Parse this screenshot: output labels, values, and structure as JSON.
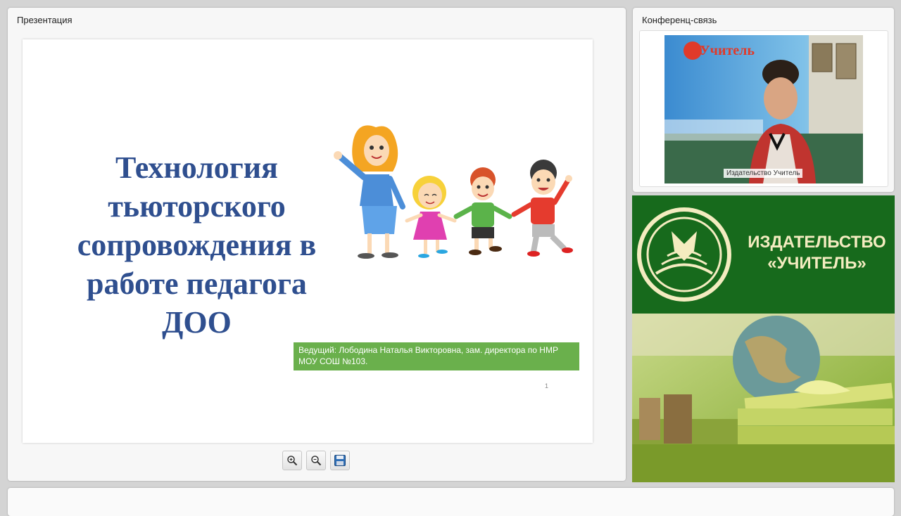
{
  "presentation": {
    "title": "Презентация",
    "slide": {
      "heading_lines": [
        "Технология",
        "тьюторского",
        "сопровождения в",
        "работе педагога",
        "ДОО"
      ],
      "presenter": "Ведущий: Лободина Наталья Викторовна, зам. директора по НМР МОУ СОШ №103.",
      "number": "1"
    },
    "toolbar": [
      {
        "name": "zoom-in-button",
        "icon": "zoom-in-icon"
      },
      {
        "name": "zoom-out-button",
        "icon": "zoom-out-icon"
      },
      {
        "name": "save-button",
        "icon": "save-icon"
      }
    ]
  },
  "conference": {
    "title": "Конференц-связь",
    "video_caption": "Издательство Учитель",
    "backdrop_text": "Учитель"
  },
  "publisher": {
    "name_line1": "ИЗДАТЕЛЬСТВО",
    "name_line2": "«УЧИТЕЛЬ»",
    "colors": {
      "green": "#176a1c",
      "gold": "#f4ecc0"
    }
  },
  "colors": {
    "heading": "#2f4f8f",
    "presenter_box": "#6ab04c"
  }
}
